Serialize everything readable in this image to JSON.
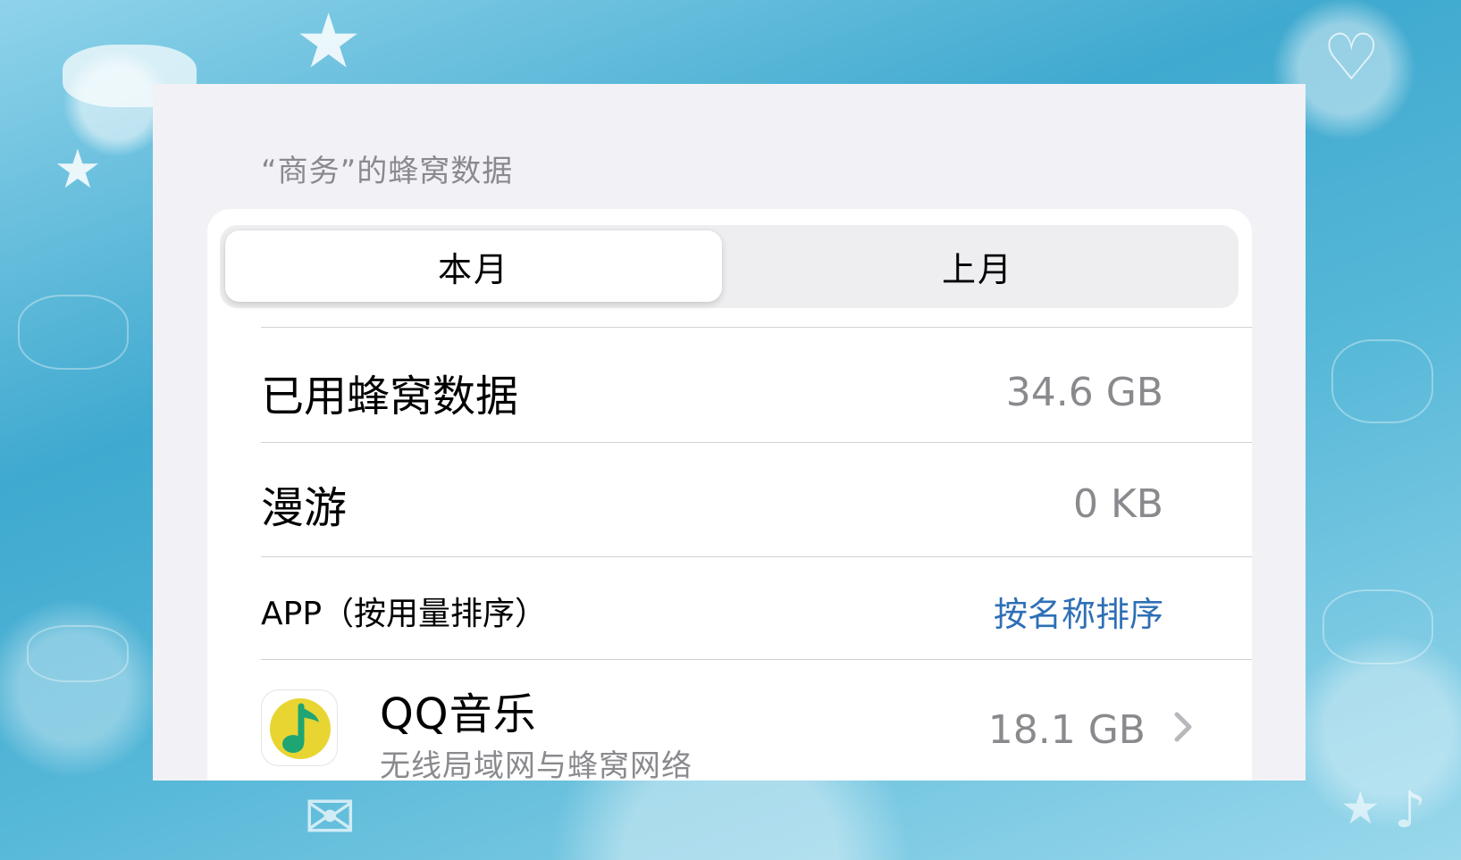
{
  "section": {
    "header": "“商务”的蜂窝数据"
  },
  "segment": {
    "current_month": "本月",
    "last_month": "上月",
    "selected": "本月"
  },
  "usage": {
    "cellular_label": "已用蜂窝数据",
    "cellular_value": "34.6 GB",
    "roaming_label": "漫游",
    "roaming_value": "0 KB"
  },
  "apps_header": {
    "label": "APP（按用量排序）",
    "sort_link": "按名称排序"
  },
  "apps": [
    {
      "name": "QQ音乐",
      "subtitle": "无线局域网与蜂窝网络",
      "size": "18.1 GB",
      "icon": "qq-music-icon"
    }
  ],
  "colors": {
    "link": "#2f6fb6",
    "secondary_text": "#8a8a8e",
    "sheet_background": "#f2f2f6",
    "card_background": "#ffffff",
    "qq_music_yellow": "#e8d532",
    "qq_music_green": "#1fa574"
  }
}
